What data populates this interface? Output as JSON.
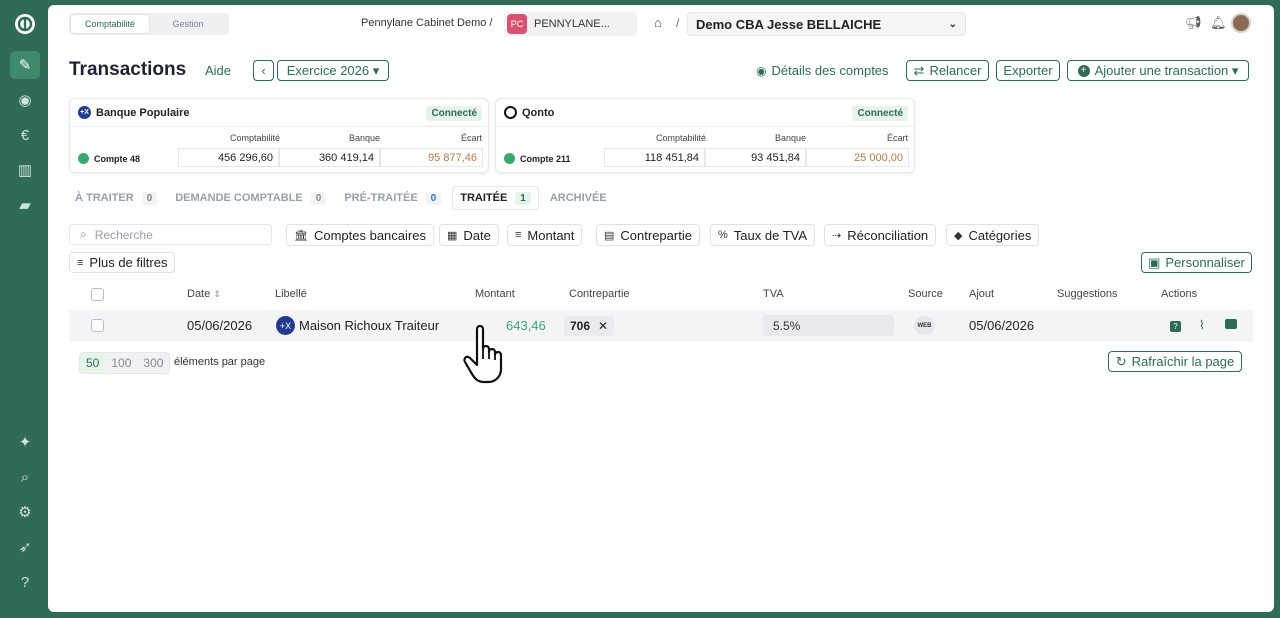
{
  "toggle": {
    "left": "Comptabilité",
    "right": "Gestion"
  },
  "header": {
    "cabinet": "Pennylane Cabinet Demo /",
    "org_badge": "PC",
    "org_name": "PENNYLANE...",
    "company": "Demo CBA Jesse BELLAICHE",
    "icons": [
      "home-icon",
      "megaphone-icon",
      "bell-icon",
      "avatar"
    ]
  },
  "page": {
    "title": "Transactions",
    "help": "Aide",
    "prev": "‹",
    "fiscal_year": "Exercice 2026 ▾",
    "account_details": "Détails des comptes",
    "relancer": "Relancer",
    "exporter": "Exporter",
    "add_transaction": "Ajouter une transaction ▾"
  },
  "banks": [
    {
      "name": "Banque Populaire",
      "status": "Connecté",
      "col_compta": "Comptabilité",
      "col_banque": "Banque",
      "col_ecart": "Écart",
      "account": "Compte 48",
      "compta": "456 296,60",
      "banque": "360 419,14",
      "ecart": "95 877,46"
    },
    {
      "name": "Qonto",
      "status": "Connecté",
      "col_compta": "Comptabilité",
      "col_banque": "Banque",
      "col_ecart": "Écart",
      "account": "Compte 211",
      "compta": "118 451,84",
      "banque": "93 451,84",
      "ecart": "25 000,00"
    }
  ],
  "tabs": [
    {
      "label": "À TRAITER",
      "count": "0"
    },
    {
      "label": "DEMANDE COMPTABLE",
      "count": "0"
    },
    {
      "label": "PRÉ-TRAITÉE",
      "count": "0"
    },
    {
      "label": "TRAITÉE",
      "count": "1"
    },
    {
      "label": "ARCHIVÉE",
      "count": ""
    }
  ],
  "filters": {
    "search_placeholder": "Recherche",
    "comptes_bancaires": "Comptes bancaires",
    "date": "Date",
    "montant": "Montant",
    "contrepartie": "Contrepartie",
    "taux_tva": "Taux de TVA",
    "reconciliation": "Réconciliation",
    "categories": "Catégories",
    "more_filters": "Plus de filtres",
    "personnaliser": "Personnaliser"
  },
  "table": {
    "headers": {
      "date": "Date",
      "libelle": "Libellé",
      "montant": "Montant",
      "contrepartie": "Contrepartie",
      "tva": "TVA",
      "source": "Source",
      "ajout": "Ajout",
      "suggestions": "Suggestions",
      "actions": "Actions"
    },
    "rows": [
      {
        "date": "05/06/2026",
        "libelle": "Maison Richoux Traiteur",
        "montant": "643,46",
        "contrepartie": "706",
        "tva": "5.5%",
        "source": "WEB",
        "ajout": "05/06/2026"
      }
    ]
  },
  "footer": {
    "page_sizes": [
      "50",
      "100",
      "300"
    ],
    "per_page": "éléments par page",
    "refresh": "Rafraîchir la page"
  },
  "colors": {
    "brand": "#2f6b55",
    "amount_positive": "#3aa76d",
    "ecart": "#b57a4a"
  }
}
